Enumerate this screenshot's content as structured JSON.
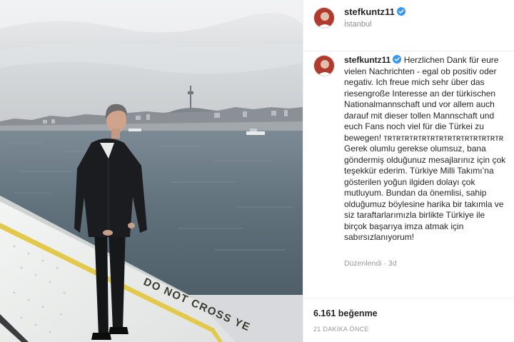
{
  "post": {
    "username": "stefkuntz11",
    "verified": true,
    "location": "İstanbul",
    "caption_user": "stefkuntz11",
    "caption_text": "Herzlichen Dank für eure vielen Nachrichten - egal ob positiv oder negativ. Ich freue mich sehr über das riesengroße Interesse an der türkischen Nationalmannschaft und vor allem auch darauf mit dieser tollen Mannschaft und euch Fans noch viel für die Türkei zu bewegen! ᴛʀᴛʀᴛʀᴛʀᴛʀᴛʀᴛʀᴛʀᴛʀᴛʀᴛʀᴛʀᴛʀᴛʀ Gerek olumlu gerekse olumsuz, bana göndermiş olduğunuz mesajlarınız için çok teşekkür ederim. Türkiye Milli Takımı’na gösterilen yoğun ilgiden dolayı çok mutluyum. Bundan da önemlisi, sahip olduğumuz böylesine harika bir takımla ve siz taraftarlarımızla birlikte Türkiye ile birçok başarıya imza atmak için sabırsızlanıyorum!",
    "edited_label": "Düzenlendi",
    "separator": "·",
    "age": "3d",
    "likes": "6.161 beğenme",
    "time_ago": "21 DAKİKA ÖNCE"
  },
  "photo": {
    "sign_text": "DO NOT CROSS YE"
  },
  "colors": {
    "verified": "#3897f0",
    "muted_text": "#8e8e8e",
    "sea": "#5d6d78",
    "sky": "#d4d7da"
  },
  "icons": {
    "verified": "verified-badge-icon",
    "avatar": "user-avatar"
  }
}
